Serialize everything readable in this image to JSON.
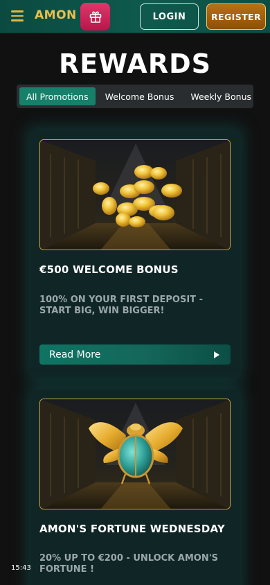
{
  "header": {
    "logo": "AMON",
    "login_label": "LOGIN",
    "register_label": "REGISTER",
    "icons": {
      "menu": "hamburger-menu-icon",
      "gift": "gift-icon"
    },
    "colors": {
      "brand_gold": "#e2b948",
      "header_bg": "#0f5a4d",
      "gift_bg": "#d42a5c",
      "register_bg": "#a9670f"
    }
  },
  "page": {
    "title": "REWARDS",
    "tabs": [
      {
        "label": "All Promotions",
        "active": true
      },
      {
        "label": "Welcome Bonus",
        "active": false
      },
      {
        "label": "Weekly Bonus",
        "active": false
      }
    ]
  },
  "promotions": [
    {
      "image": "gold-coins-temple-image",
      "title": "€500 WELCOME BONUS",
      "description": "100% ON YOUR FIRST DEPOSIT - START BIG, WIN BIGGER!",
      "cta_label": "Read More"
    },
    {
      "image": "golden-scarab-temple-image",
      "title": "AMON'S FORTUNE WEDNESDAY",
      "description": "20% UP TO €200 - UNLOCK AMON'S FORTUNE !"
    }
  ],
  "status": {
    "time": "15:43"
  },
  "colors": {
    "accent": "#17806b",
    "card_glow": "#11524e",
    "image_border": "#c9a743"
  }
}
